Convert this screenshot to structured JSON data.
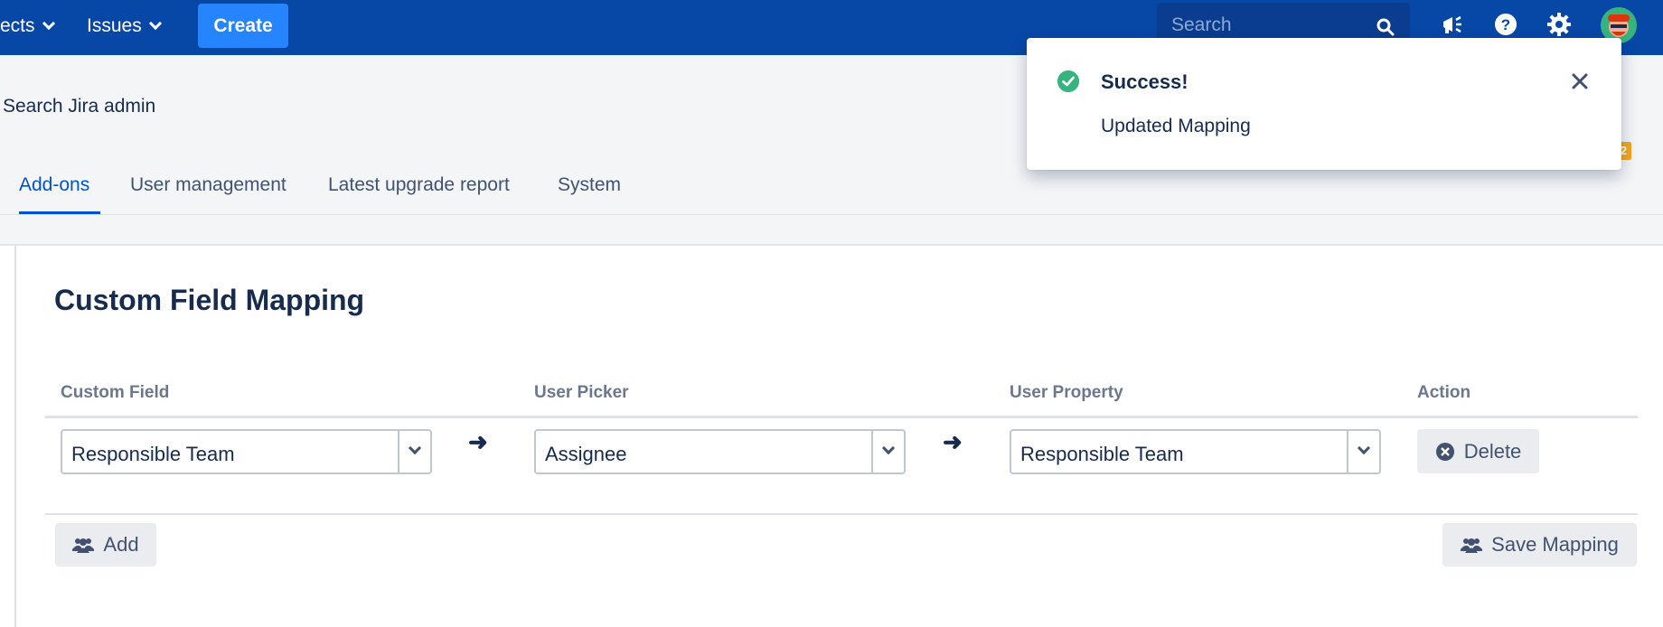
{
  "nav": {
    "projects_label": "ects",
    "issues_label": "Issues",
    "create_label": "Create",
    "search_placeholder": "Search"
  },
  "admin": {
    "search_label": "Search Jira admin",
    "tabs": [
      {
        "label": "Add-ons",
        "active": true
      },
      {
        "label": "User management",
        "active": false
      },
      {
        "label": "Latest upgrade report",
        "active": false
      },
      {
        "label": "System",
        "active": false
      }
    ],
    "badge": "2"
  },
  "page": {
    "title": "Custom Field Mapping"
  },
  "table": {
    "headers": [
      "Custom Field",
      "User Picker",
      "User Property",
      "Action"
    ],
    "rows": [
      {
        "custom_field": "Responsible Team",
        "user_picker": "Assignee",
        "user_property": "Responsible Team",
        "action_label": "Delete"
      }
    ],
    "arrow": "➜"
  },
  "buttons": {
    "add_label": "Add",
    "save_label": "Save Mapping"
  },
  "toast": {
    "title": "Success!",
    "message": "Updated Mapping"
  },
  "colors": {
    "nav_bg": "#0747a6",
    "create_bg": "#2684ff",
    "active_tab": "#0052cc",
    "success": "#36b37e"
  },
  "icons": {
    "search": "search-icon",
    "notifications": "megaphone-icon",
    "help": "help-icon",
    "settings": "gear-icon",
    "close": "close-icon",
    "delete": "delete-circle-icon",
    "add": "users-icon",
    "save": "users-icon"
  }
}
